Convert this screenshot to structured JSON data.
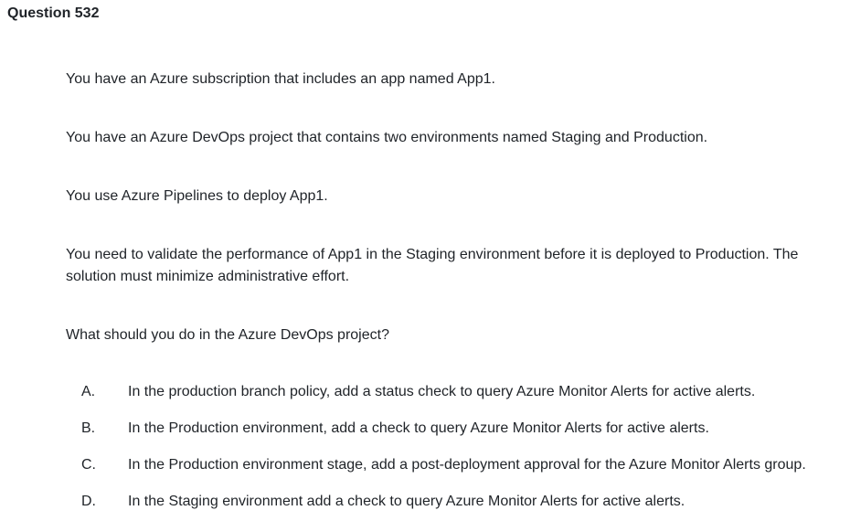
{
  "question": {
    "title": "Question 532",
    "paragraphs": [
      "You have an Azure subscription that includes an app named App1.",
      "You have an Azure DevOps project that contains two environments named Staging and Production.",
      "You use Azure Pipelines to deploy App1.",
      "You need to validate the performance of App1 in the Staging environment before it is deployed to Production. The solution must minimize administrative effort.",
      "What should you do in the Azure DevOps project?"
    ],
    "options": [
      {
        "letter": "A.",
        "text": "In the production branch policy, add a status check to query Azure Monitor Alerts for active alerts."
      },
      {
        "letter": "B.",
        "text": "In the Production environment, add a check to query Azure Monitor Alerts for active alerts."
      },
      {
        "letter": "C.",
        "text": "In the Production environment stage, add a post-deployment approval for the Azure Monitor Alerts group."
      },
      {
        "letter": "D.",
        "text": "In the Staging environment add a check to query Azure Monitor Alerts for active alerts."
      }
    ]
  }
}
